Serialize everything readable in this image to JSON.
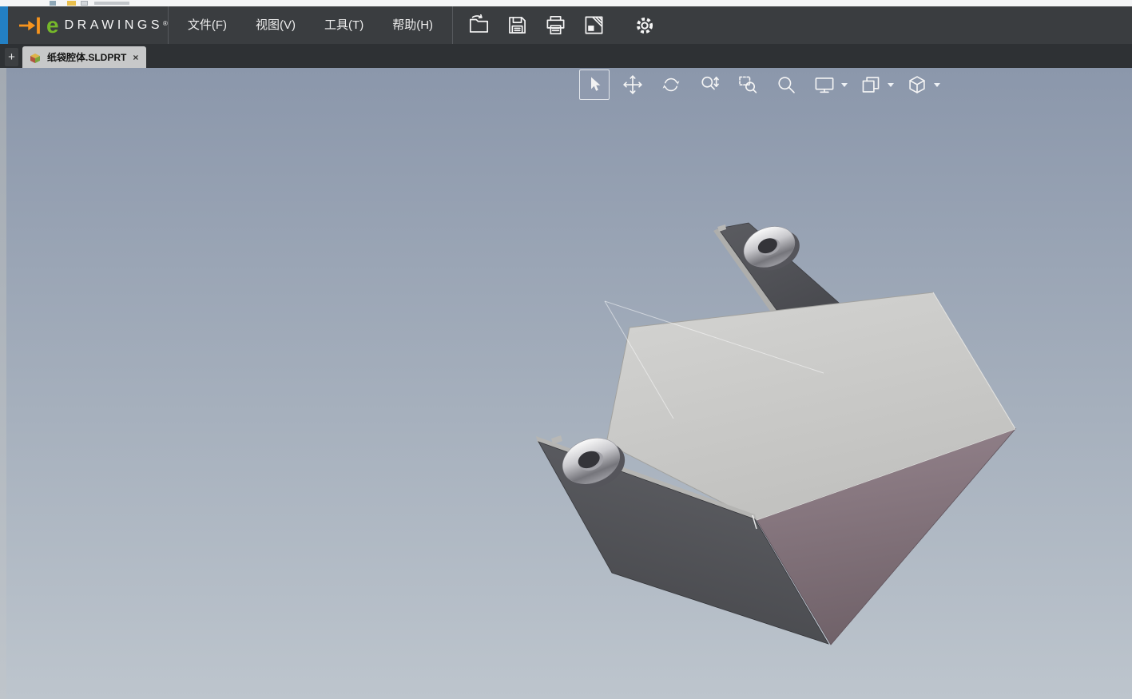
{
  "brand": {
    "e_mark": "e",
    "name": "DRAWINGS",
    "registered": "®",
    "arrow_color": "#f7941d",
    "e_color": "#76b82a"
  },
  "menu_bar": {
    "items": [
      {
        "label": "文件(F)"
      },
      {
        "label": "视图(V)"
      },
      {
        "label": "工具(T)"
      },
      {
        "label": "帮助(H)"
      }
    ]
  },
  "quick_toolbar": {
    "buttons": [
      {
        "name": "open",
        "icon": "open-file-icon"
      },
      {
        "name": "save",
        "icon": "save-icon"
      },
      {
        "name": "print",
        "icon": "print-icon"
      },
      {
        "name": "send",
        "icon": "send-icon"
      },
      {
        "name": "options",
        "icon": "gear-icon"
      }
    ]
  },
  "tab_bar": {
    "new_tab_label": "+",
    "tabs": [
      {
        "label": "纸袋腔体.SLDPRT",
        "close_label": "×",
        "active": true,
        "icon": "part-document-icon"
      }
    ]
  },
  "view_toolbar": {
    "buttons": [
      {
        "name": "select",
        "icon": "select-arrow-icon",
        "active": true
      },
      {
        "name": "pan",
        "icon": "pan-icon"
      },
      {
        "name": "rotate",
        "icon": "rotate-icon"
      },
      {
        "name": "zoom",
        "icon": "zoom-in-out-icon"
      },
      {
        "name": "zoom-area",
        "icon": "zoom-area-icon"
      },
      {
        "name": "zoom-fit",
        "icon": "zoom-fit-icon"
      },
      {
        "name": "fullscreen",
        "icon": "monitor-icon",
        "has_dropdown": true
      },
      {
        "name": "sheets",
        "icon": "pages-icon",
        "has_dropdown": true
      },
      {
        "name": "orientation",
        "icon": "cube-icon",
        "has_dropdown": true
      }
    ]
  },
  "viewport": {
    "background_top": "#8b97ab",
    "background_bottom": "#bdc5cd",
    "model_colors": {
      "top_face": "#cccccb",
      "right_face": "#8a7a82",
      "dark_faces": "#55565b",
      "ring_metal": "#d9d9dd"
    }
  },
  "window_colors": {
    "header_bg": "#3a3d40",
    "edge_accent": "#2380c4",
    "tab_active_bg": "#c7c8c9",
    "tab_bar_bg": "#2e3134"
  }
}
